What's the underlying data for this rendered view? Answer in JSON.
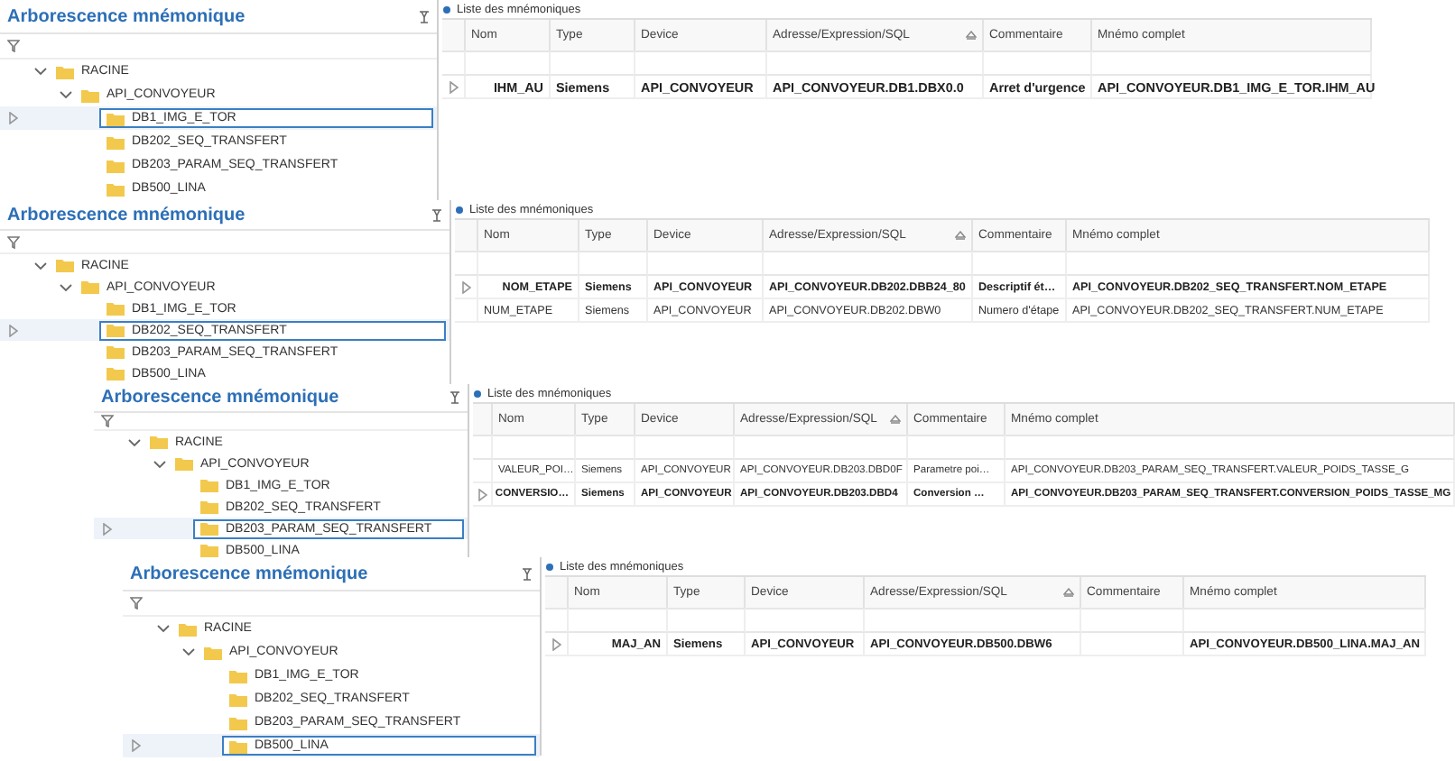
{
  "panels": [
    {
      "tree": {
        "title": "Arborescence mnémonique",
        "items": [
          {
            "label": "RACINE",
            "expanded": true,
            "children": [
              {
                "label": "API_CONVOYEUR",
                "expanded": true,
                "children": [
                  {
                    "label": "DB1_IMG_E_TOR",
                    "selected": true
                  },
                  {
                    "label": "DB202_SEQ_TRANSFERT",
                    "selected": false
                  },
                  {
                    "label": "DB203_PARAM_SEQ_TRANSFERT",
                    "selected": false
                  },
                  {
                    "label": "DB500_LINA",
                    "selected": false
                  }
                ]
              }
            ]
          }
        ]
      },
      "table": {
        "title": "Liste des mnémoniques",
        "columns": [
          {
            "label": "Nom",
            "sorted": false
          },
          {
            "label": "Type",
            "sorted": false
          },
          {
            "label": "Device",
            "sorted": false
          },
          {
            "label": "Adresse/Expression/SQL",
            "sorted": true
          },
          {
            "label": "Commentaire",
            "sorted": false
          },
          {
            "label": "Mnémo complet",
            "sorted": false
          }
        ],
        "rows": [
          {
            "selected": true,
            "cells": [
              "IHM_AU",
              "Siemens",
              "API_CONVOYEUR",
              "API_CONVOYEUR.DB1.DBX0.0",
              "Arret d'urgence",
              "API_CONVOYEUR.DB1_IMG_E_TOR.IHM_AU"
            ]
          }
        ]
      }
    },
    {
      "tree": {
        "title": "Arborescence mnémonique",
        "items": [
          {
            "label": "RACINE",
            "expanded": true,
            "children": [
              {
                "label": "API_CONVOYEUR",
                "expanded": true,
                "children": [
                  {
                    "label": "DB1_IMG_E_TOR",
                    "selected": false
                  },
                  {
                    "label": "DB202_SEQ_TRANSFERT",
                    "selected": true
                  },
                  {
                    "label": "DB203_PARAM_SEQ_TRANSFERT",
                    "selected": false
                  },
                  {
                    "label": "DB500_LINA",
                    "selected": false
                  }
                ]
              }
            ]
          }
        ]
      },
      "table": {
        "title": "Liste des mnémoniques",
        "columns": [
          {
            "label": "Nom",
            "sorted": false
          },
          {
            "label": "Type",
            "sorted": false
          },
          {
            "label": "Device",
            "sorted": false
          },
          {
            "label": "Adresse/Expression/SQL",
            "sorted": true
          },
          {
            "label": "Commentaire",
            "sorted": false
          },
          {
            "label": "Mnémo complet",
            "sorted": false
          }
        ],
        "rows": [
          {
            "selected": true,
            "cells": [
              "NOM_ETAPE",
              "Siemens",
              "API_CONVOYEUR",
              "API_CONVOYEUR.DB202.DBB24_80",
              "Descriptif ét…",
              "API_CONVOYEUR.DB202_SEQ_TRANSFERT.NOM_ETAPE"
            ]
          },
          {
            "selected": false,
            "cells": [
              "NUM_ETAPE",
              "Siemens",
              "API_CONVOYEUR",
              "API_CONVOYEUR.DB202.DBW0",
              "Numero d'étape",
              "API_CONVOYEUR.DB202_SEQ_TRANSFERT.NUM_ETAPE"
            ]
          }
        ]
      }
    },
    {
      "tree": {
        "title": "Arborescence mnémonique",
        "items": [
          {
            "label": "RACINE",
            "expanded": true,
            "children": [
              {
                "label": "API_CONVOYEUR",
                "expanded": true,
                "children": [
                  {
                    "label": "DB1_IMG_E_TOR",
                    "selected": false
                  },
                  {
                    "label": "DB202_SEQ_TRANSFERT",
                    "selected": false
                  },
                  {
                    "label": "DB203_PARAM_SEQ_TRANSFERT",
                    "selected": true
                  },
                  {
                    "label": "DB500_LINA",
                    "selected": false
                  }
                ]
              }
            ]
          }
        ]
      },
      "table": {
        "title": "Liste des mnémoniques",
        "columns": [
          {
            "label": "Nom",
            "sorted": false
          },
          {
            "label": "Type",
            "sorted": false
          },
          {
            "label": "Device",
            "sorted": false
          },
          {
            "label": "Adresse/Expression/SQL",
            "sorted": true
          },
          {
            "label": "Commentaire",
            "sorted": false
          },
          {
            "label": "Mnémo complet",
            "sorted": false
          }
        ],
        "rows": [
          {
            "selected": false,
            "cells": [
              "VALEUR_POI…",
              "Siemens",
              "API_CONVOYEUR",
              "API_CONVOYEUR.DB203.DBD0F",
              "Parametre poi…",
              "API_CONVOYEUR.DB203_PARAM_SEQ_TRANSFERT.VALEUR_POIDS_TASSE_G"
            ]
          },
          {
            "selected": true,
            "cells": [
              "CONVERSIO…",
              "Siemens",
              "API_CONVOYEUR",
              "API_CONVOYEUR.DB203.DBD4",
              "Conversion …",
              "API_CONVOYEUR.DB203_PARAM_SEQ_TRANSFERT.CONVERSION_POIDS_TASSE_MG"
            ]
          }
        ]
      }
    },
    {
      "tree": {
        "title": "Arborescence mnémonique",
        "items": [
          {
            "label": "RACINE",
            "expanded": true,
            "children": [
              {
                "label": "API_CONVOYEUR",
                "expanded": true,
                "children": [
                  {
                    "label": "DB1_IMG_E_TOR",
                    "selected": false
                  },
                  {
                    "label": "DB202_SEQ_TRANSFERT",
                    "selected": false
                  },
                  {
                    "label": "DB203_PARAM_SEQ_TRANSFERT",
                    "selected": false
                  },
                  {
                    "label": "DB500_LINA",
                    "selected": true
                  }
                ]
              }
            ]
          }
        ]
      },
      "table": {
        "title": "Liste des mnémoniques",
        "columns": [
          {
            "label": "Nom",
            "sorted": false
          },
          {
            "label": "Type",
            "sorted": false
          },
          {
            "label": "Device",
            "sorted": false
          },
          {
            "label": "Adresse/Expression/SQL",
            "sorted": true
          },
          {
            "label": "Commentaire",
            "sorted": false
          },
          {
            "label": "Mnémo complet",
            "sorted": false
          }
        ],
        "rows": [
          {
            "selected": true,
            "cells": [
              "MAJ_AN",
              "Siemens",
              "API_CONVOYEUR",
              "API_CONVOYEUR.DB500.DBW6",
              "",
              "API_CONVOYEUR.DB500_LINA.MAJ_AN"
            ]
          }
        ]
      }
    }
  ]
}
